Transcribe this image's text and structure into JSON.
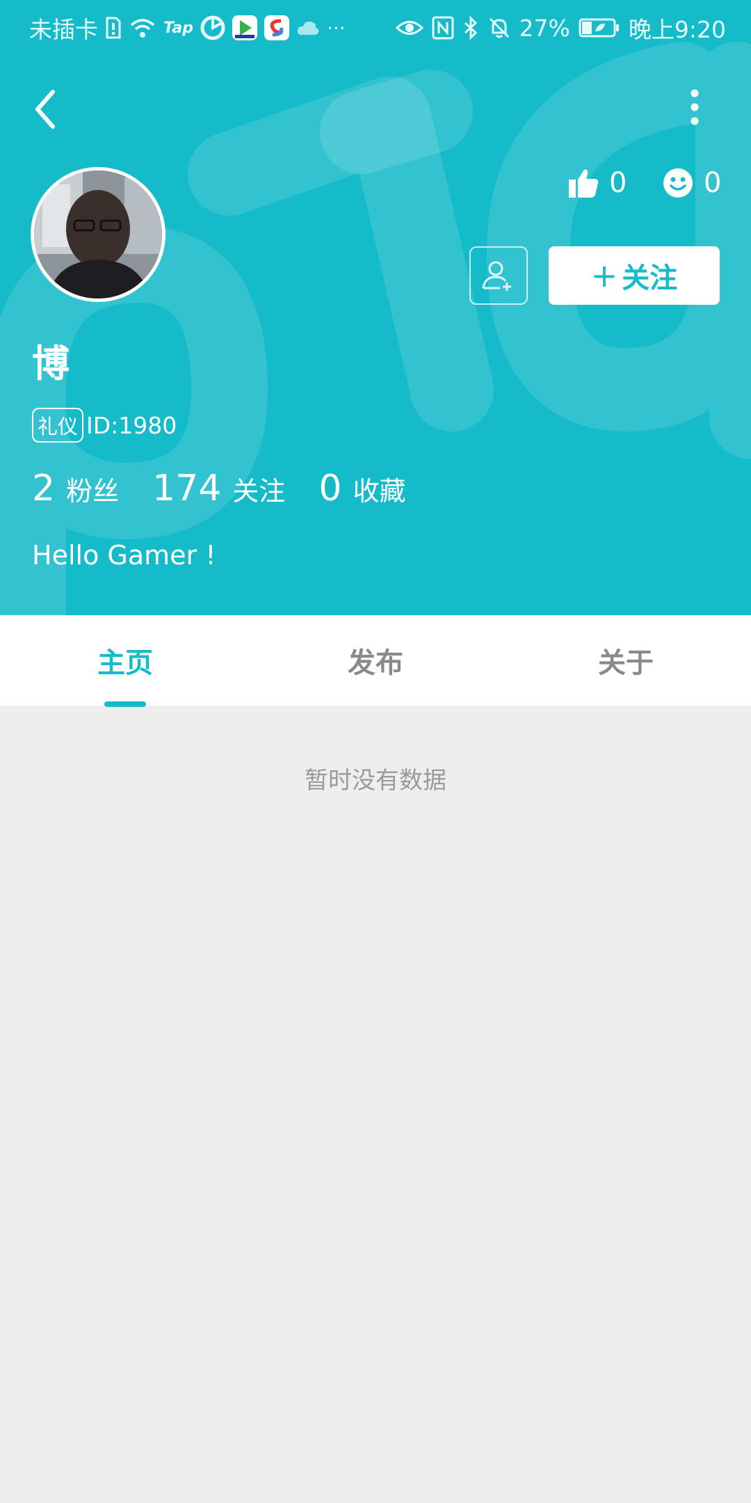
{
  "colors": {
    "accent": "#15BBC9",
    "background": "#EEEEEE",
    "tab_inactive": "#8A8A8A",
    "empty_text": "#9A9A9A"
  },
  "status_bar": {
    "carrier": "未插卡",
    "left_icons": [
      "sim-card-icon",
      "wifi-icon",
      "tap-app-icon",
      "aperture-app-icon",
      "video-app-icon",
      "store-app-icon",
      "cloud-icon",
      "more-dots-icon"
    ],
    "tap_label": "Tap",
    "more_label": "···",
    "right_icons": [
      "eye-comfort-icon",
      "nfc-icon",
      "bluetooth-icon",
      "bell-muted-icon",
      "battery-icon"
    ],
    "battery_percent": "27%",
    "time": "晚上9:20"
  },
  "nav": {
    "back_icon": "chevron-left-icon",
    "more_icon": "more-vertical-icon"
  },
  "profile": {
    "name": "博",
    "tag": "礼仪",
    "id_text": "ID:1980",
    "likes": "0",
    "smiles": "0",
    "follow_plus": "+",
    "follow_label": "关注",
    "bio": "Hello Gamer !",
    "stats": [
      {
        "value": "2",
        "label": "粉丝"
      },
      {
        "value": "174",
        "label": "关注"
      },
      {
        "value": "0",
        "label": "收藏"
      }
    ]
  },
  "tabs": [
    {
      "label": "主页",
      "active": true
    },
    {
      "label": "发布",
      "active": false
    },
    {
      "label": "关于",
      "active": false
    }
  ],
  "empty_state": "暂时没有数据"
}
